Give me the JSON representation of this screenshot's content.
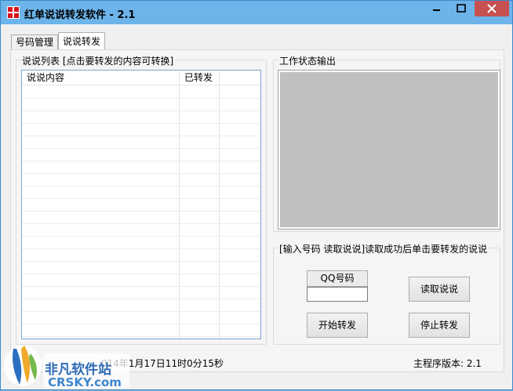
{
  "window": {
    "title": "红单说说转发软件 - 2.1",
    "minimize_icon": "minimize-icon",
    "maximize_icon": "maximize-icon",
    "close_icon": "close-icon"
  },
  "tabs": [
    {
      "label": "号码管理",
      "active": false
    },
    {
      "label": "说说转发",
      "active": true
    }
  ],
  "list_group": {
    "label": "说说列表 [点击要转发的内容可转换]",
    "columns": [
      "说说内容",
      "已转发",
      ""
    ],
    "rows": []
  },
  "output_group": {
    "label": "工作状态输出"
  },
  "action_group": {
    "label": "[输入号码 读取说说]读取成功后单击要转发的说说",
    "qq_label": "QQ号码",
    "qq_value": "",
    "read_button": "读取说说",
    "start_button": "开始转发",
    "stop_button": "停止转发"
  },
  "status": {
    "left_text": "014年1月17日11时0分15秒",
    "right_text": "主程序版本: 2.1"
  },
  "watermark": {
    "line1": "非凡软件站",
    "line2": "CRSKY.com"
  },
  "colors": {
    "titlebar": "#6cb4ea",
    "close_button": "#c75050",
    "output_bg": "#c0c0c0"
  }
}
